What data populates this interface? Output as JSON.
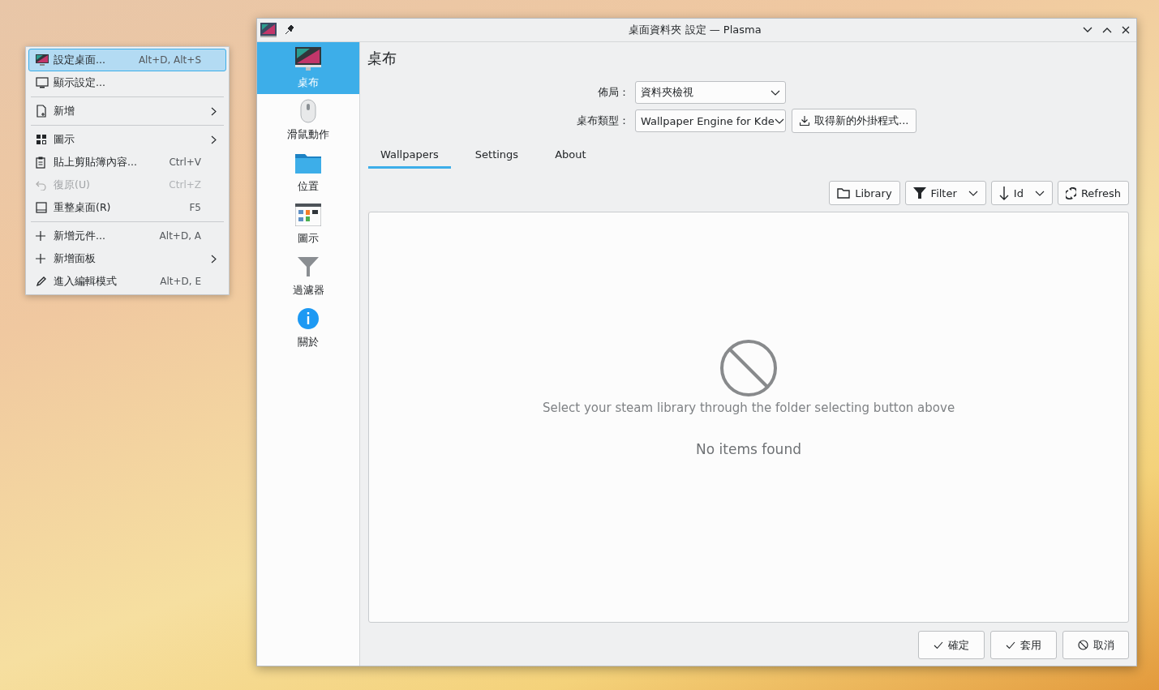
{
  "context_menu": {
    "items": [
      {
        "kind": "item",
        "label": "設定桌面...",
        "shortcut": "Alt+D, Alt+S",
        "submenu": false,
        "disabled": false,
        "selected": true
      },
      {
        "kind": "item",
        "label": "顯示設定...",
        "submenu": false,
        "disabled": false,
        "selected": false
      },
      {
        "kind": "separator"
      },
      {
        "kind": "item",
        "label": "新增",
        "submenu": true,
        "disabled": false,
        "selected": false
      },
      {
        "kind": "separator"
      },
      {
        "kind": "item",
        "label": "圖示",
        "submenu": true,
        "disabled": false,
        "selected": false
      },
      {
        "kind": "item",
        "label": "貼上剪貼簿內容...",
        "shortcut": "Ctrl+V",
        "submenu": false,
        "disabled": false,
        "selected": false
      },
      {
        "kind": "item",
        "label": "復原(U)",
        "shortcut": "Ctrl+Z",
        "submenu": false,
        "disabled": true,
        "selected": false
      },
      {
        "kind": "item",
        "label": "重整桌面(R)",
        "shortcut": "F5",
        "submenu": false,
        "disabled": false,
        "selected": false
      },
      {
        "kind": "separator"
      },
      {
        "kind": "item",
        "label": "新增元件...",
        "shortcut": "Alt+D, A",
        "submenu": false,
        "disabled": false,
        "selected": false
      },
      {
        "kind": "item",
        "label": "新增面板",
        "submenu": true,
        "disabled": false,
        "selected": false
      },
      {
        "kind": "item",
        "label": "進入編輯模式",
        "shortcut": "Alt+D, E",
        "submenu": false,
        "disabled": false,
        "selected": false
      }
    ]
  },
  "window": {
    "title": "桌面資料夾 設定 — Plasma"
  },
  "sidebar": {
    "items": [
      {
        "label": "桌布",
        "selected": true
      },
      {
        "label": "滑鼠動作",
        "selected": false
      },
      {
        "label": "位置",
        "selected": false
      },
      {
        "label": "圖示",
        "selected": false
      },
      {
        "label": "過濾器",
        "selected": false
      },
      {
        "label": "關於",
        "selected": false
      }
    ]
  },
  "page": {
    "title": "桌布",
    "form": [
      {
        "label": "佈局：",
        "value": "資料夾檢視"
      },
      {
        "label": "桌布類型：",
        "value": "Wallpaper Engine for Kde",
        "button": "取得新的外掛程式..."
      }
    ],
    "tabs": [
      {
        "label": "Wallpapers",
        "selected": true
      },
      {
        "label": "Settings",
        "selected": false
      },
      {
        "label": "About",
        "selected": false
      }
    ],
    "toolbar": [
      {
        "label": "Library",
        "dropdown": false
      },
      {
        "label": "Filter",
        "dropdown": true
      },
      {
        "label": "Id",
        "dropdown": true
      },
      {
        "label": "Refresh",
        "dropdown": false
      }
    ],
    "hint": "Select your steam library through the folder selecting button above",
    "empty_message": "No items found"
  },
  "buttons": [
    "確定",
    "套用",
    "取消"
  ]
}
